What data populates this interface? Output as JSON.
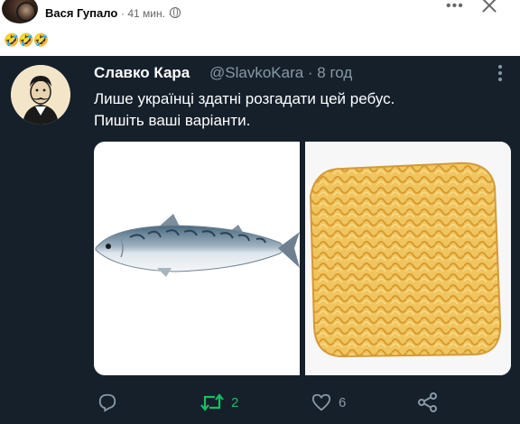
{
  "facebook_post": {
    "author": "Вася Гупало",
    "meta": "· 41 мин. ·",
    "emojis": "🤣🤣🤣"
  },
  "tweet": {
    "display_name": "Славко Кара",
    "handle_time": "@SlavkoKara · 8 год",
    "text_line1": "Лише українці здатні розгадати цей ребус.",
    "text_line2": "Пишіть ваші варіанти.",
    "retweets": "2",
    "likes": "6"
  },
  "colors": {
    "tweet_bg": "#15202b",
    "retweet_green": "#17bf63",
    "secondary_text": "#8899a6"
  },
  "icons": [
    "more-icon",
    "close-icon",
    "globe-icon",
    "reply-icon",
    "retweet-icon",
    "like-icon",
    "share-icon",
    "tweet-more-icon"
  ]
}
